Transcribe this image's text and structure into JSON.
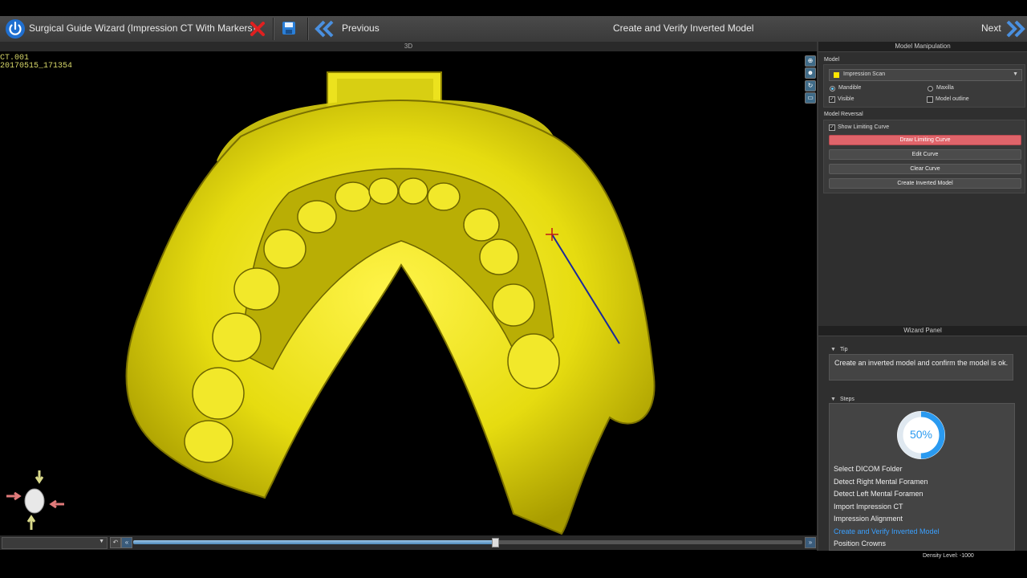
{
  "toolbar": {
    "title": "Surgical Guide Wizard (Impression CT With Markers)",
    "previous_label": "Previous",
    "step_title": "Create and Verify Inverted Model",
    "next_label": "Next"
  },
  "viewport": {
    "title": "3D",
    "overlay_line1": "CT.001",
    "overlay_line2": "20170515_171354"
  },
  "model_manipulation": {
    "header": "Model Manipulation",
    "model_label": "Model",
    "model_selected": "Impression Scan",
    "model_color": "#ffe600",
    "mandible_label": "Mandible",
    "maxilla_label": "Maxilla",
    "visible_label": "Visible",
    "model_outline_label": "Model outline",
    "mandible_selected": true,
    "visible_checked": true,
    "outline_checked": false
  },
  "model_reversal": {
    "header": "Model Reversal",
    "show_limiting_curve_label": "Show Limiting Curve",
    "show_limiting_curve_checked": true,
    "buttons": {
      "draw": "Draw Limiting Curve",
      "edit": "Edit Curve",
      "clear": "Clear Curve",
      "create": "Create Inverted Model"
    }
  },
  "wizard_panel": {
    "header": "Wizard Panel",
    "tip_header": "Tip",
    "tip_text": "Create an inverted model and confirm the model is ok.",
    "steps_header": "Steps",
    "progress_label": "50%",
    "progress": 0.5,
    "steps": [
      "Select DICOM Folder",
      "Detect Right Mental Foramen",
      "Detect Left Mental Foramen",
      "Import Impression CT",
      "Impression Alignment",
      "Create and Verify Inverted Model",
      "Position Crowns"
    ],
    "current_step_index": 5
  },
  "status": {
    "density_level": "Density Level: -1000"
  },
  "slider": {
    "value": 0.54
  },
  "colors": {
    "accent": "#3aa0ff",
    "model": "#ffef1f",
    "danger_button": "#e0646a"
  }
}
